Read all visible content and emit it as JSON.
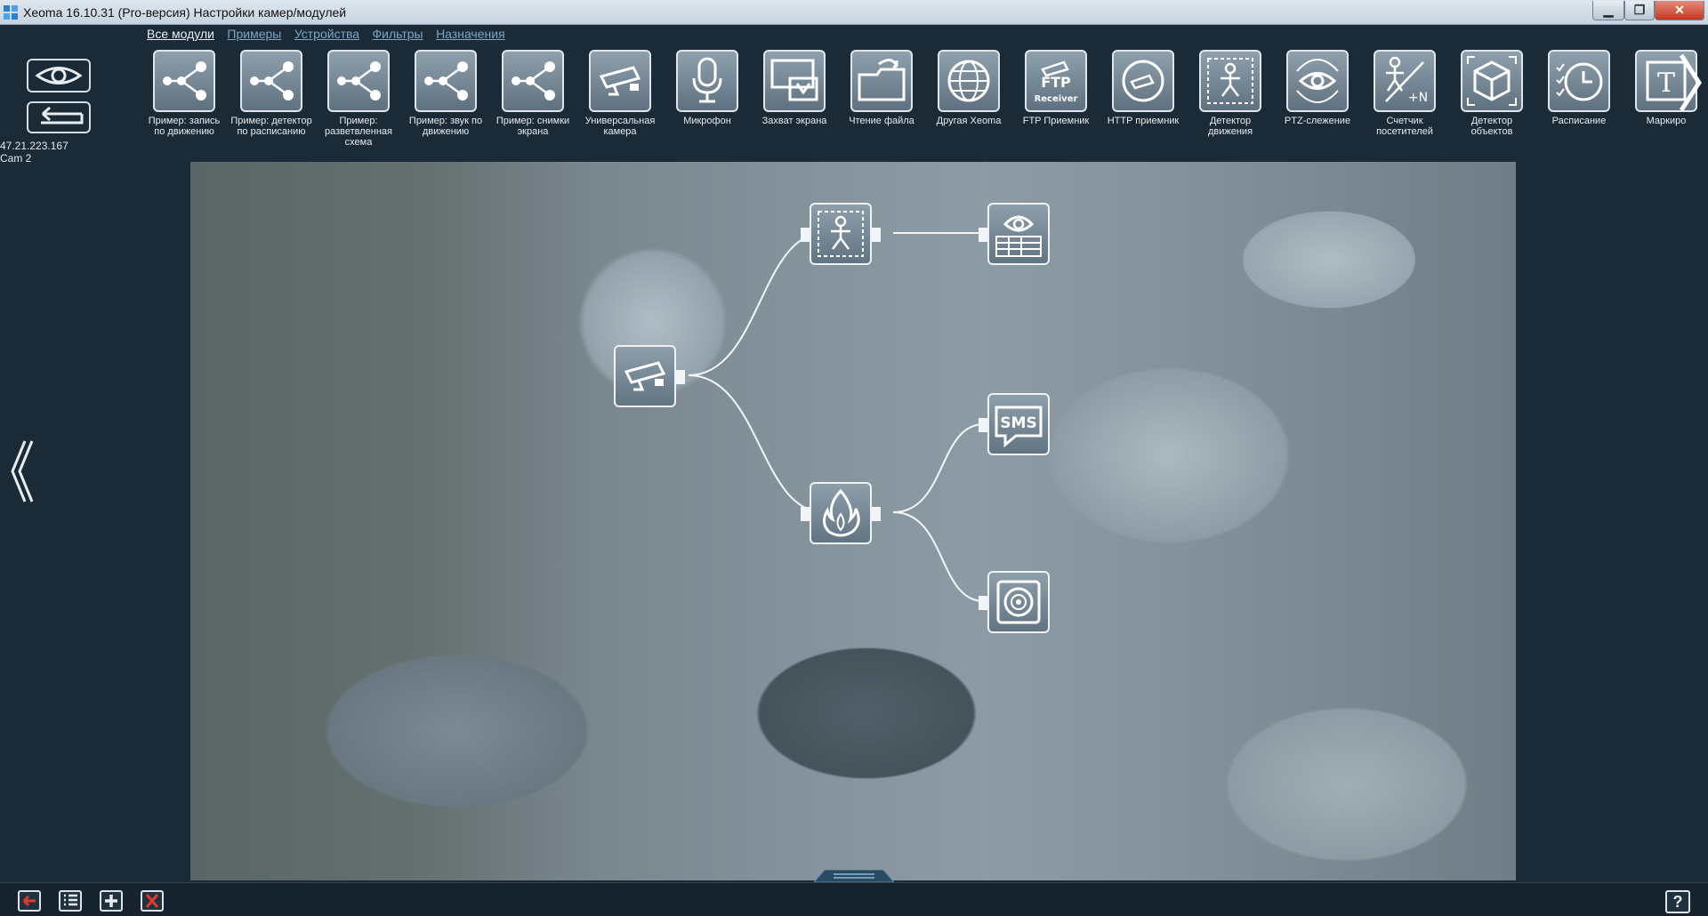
{
  "window": {
    "title": "Xeoma 16.10.31 (Pro-версия) Настройки камер/модулей",
    "controls": {
      "minimize": "▁",
      "maximize": "❐",
      "close": "✕"
    }
  },
  "tabs": [
    {
      "label": "Все модули",
      "active": true
    },
    {
      "label": "Примеры",
      "active": false
    },
    {
      "label": "Устройства",
      "active": false
    },
    {
      "label": "Фильтры",
      "active": false
    },
    {
      "label": "Назначения",
      "active": false
    }
  ],
  "left_panel": {
    "ip": "47.21.223.167",
    "cam": "Cam  2",
    "icons": [
      "eye-icon",
      "back-arrow-icon",
      "chevron-left-icon"
    ]
  },
  "modules": [
    {
      "label": "Пример: запись по движению",
      "icon": "scheme-icon"
    },
    {
      "label": "Пример: детектор по расписанию",
      "icon": "scheme-icon"
    },
    {
      "label": "Пример: разветвленная схема",
      "icon": "scheme-icon"
    },
    {
      "label": "Пример: звук по движению",
      "icon": "scheme-icon"
    },
    {
      "label": "Пример: снимки экрана",
      "icon": "scheme-icon"
    },
    {
      "label": "Универсальная камера",
      "icon": "camera-icon"
    },
    {
      "label": "Микрофон",
      "icon": "microphone-icon"
    },
    {
      "label": "Захват экрана",
      "icon": "screen-capture-icon"
    },
    {
      "label": "Чтение файла",
      "icon": "folder-icon"
    },
    {
      "label": "Другая Xeoma",
      "icon": "globe-icon"
    },
    {
      "label": "FTP Приемник",
      "icon": "ftp-receiver-icon",
      "icon_text": "FTP",
      "icon_subtext": "Receiver"
    },
    {
      "label": "HTTP приемник",
      "icon": "http-receiver-icon"
    },
    {
      "label": "Детектор движения",
      "icon": "motion-detector-icon"
    },
    {
      "label": "PTZ-слежение",
      "icon": "ptz-tracking-icon"
    },
    {
      "label": "Счетчик посетителей",
      "icon": "visitor-counter-icon",
      "icon_text": "+N"
    },
    {
      "label": "Детектор объектов",
      "icon": "object-detector-icon"
    },
    {
      "label": "Расписание",
      "icon": "schedule-icon"
    },
    {
      "label": "Маркиро",
      "icon": "marking-icon",
      "icon_text": "T"
    }
  ],
  "scheme": {
    "nodes": [
      {
        "id": "camera",
        "icon": "camera-icon"
      },
      {
        "id": "motion",
        "icon": "motion-detector-icon"
      },
      {
        "id": "viewer",
        "icon": "preview-archive-icon"
      },
      {
        "id": "fire",
        "icon": "fire-detector-icon"
      },
      {
        "id": "sms",
        "icon": "sms-icon",
        "icon_text": "SMS"
      },
      {
        "id": "sound",
        "icon": "speaker-icon"
      }
    ],
    "links": [
      [
        "camera",
        "motion"
      ],
      [
        "motion",
        "viewer"
      ],
      [
        "camera",
        "fire"
      ],
      [
        "fire",
        "sms"
      ],
      [
        "fire",
        "sound"
      ]
    ]
  },
  "camera_view": {
    "scene": "warehouse-rolls"
  },
  "bottom_bar": {
    "buttons": [
      "back-icon",
      "list-icon",
      "add-icon",
      "delete-icon"
    ],
    "help": "?"
  },
  "colors": {
    "titlebar": "#c6d3df",
    "background": "#1a2a37",
    "tab_link": "#7fa4c3",
    "tab_active": "#e8eef3",
    "delete_red": "#e03a2a"
  }
}
